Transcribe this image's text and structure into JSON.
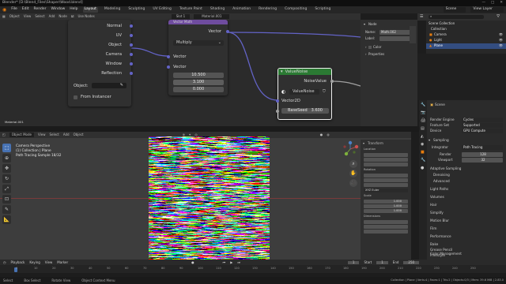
{
  "titlebar": {
    "title": "Blender* [D:\\Blend_Files\\Shaper\\Wood.blend]",
    "controls": [
      "—",
      "□",
      "✕"
    ]
  },
  "topbar": {
    "menus": [
      "File",
      "Edit",
      "Render",
      "Window",
      "Help"
    ],
    "tabs": [
      "Layout",
      "Modeling",
      "Sculpting",
      "UV Editing",
      "Texture Paint",
      "Shading",
      "Animation",
      "Rendering",
      "Compositing",
      "Scripting"
    ],
    "active_tab": "Layout",
    "scene": "Scene",
    "view_layer": "View Layer"
  },
  "node_editor": {
    "header_items": [
      "Object",
      "View",
      "Select",
      "Add",
      "Node",
      "Use Nodes"
    ],
    "slot": "Slot 1",
    "material": "Material.001",
    "material_label": "Material.001",
    "texcoord_outputs": [
      "Normal",
      "UV",
      "Object",
      "Camera",
      "Window",
      "Reflection"
    ],
    "object_label": "Object:",
    "from_instancer": "From Instancer",
    "math_node": {
      "title": "Vector Math",
      "output": "Vector",
      "operation": "Multiply",
      "input1": "Vector",
      "input2": "Vector",
      "values": [
        "10.500",
        "3.100",
        "0.000"
      ]
    },
    "noise_node": {
      "title": "ValueNoise",
      "output": "NoiseValue",
      "group": "ValueNoise",
      "input": "Vector2D",
      "seed_label": "BaseSeed",
      "seed_value": "3.600"
    }
  },
  "node_props": {
    "tab_node": "Node",
    "name_label": "Name:",
    "name_value": "Math.002",
    "label_label": "Label:",
    "color": "Color",
    "properties": "Properties"
  },
  "outliner": {
    "title": "Scene Collection",
    "items": [
      "Scene Collection",
      "Collection",
      "Camera",
      "Light",
      "Plane"
    ]
  },
  "viewport": {
    "header_items": [
      "Object Mode",
      "View",
      "Select",
      "Add",
      "Object"
    ],
    "overlay_lines": [
      "Camera Perspective",
      "(1) Collection | Plane",
      "Path Tracing Sample 18/32"
    ]
  },
  "npanel": {
    "transform": "Transform",
    "location": "Location",
    "rotation": "Rotation",
    "mode": "XYZ Euler",
    "scale": "Scale",
    "scale_values": [
      "1.000",
      "1.000",
      "1.000"
    ],
    "dimensions": "Dimensions"
  },
  "properties": {
    "scene_label": "Scene",
    "render_engine_label": "Render Engine",
    "render_engine": "Cycles",
    "feature_set_label": "Feature Set",
    "feature_set": "Supported",
    "device_label": "Device",
    "device": "GPU Compute",
    "sampling": "Sampling",
    "integrator_label": "Integrator",
    "integrator": "Path Tracing",
    "render_label": "Render",
    "render_value": "128",
    "viewport_label": "Viewport",
    "viewport_value": "32",
    "panels": [
      "Adaptive Sampling",
      "Denoising",
      "Advanced",
      "Light Paths",
      "Volumes",
      "Hair",
      "Simplify",
      "Motion Blur",
      "Film",
      "Performance",
      "Bake",
      "Grease Pencil",
      "Freestyle",
      "Color Management"
    ]
  },
  "timeline": {
    "items": [
      "Playback",
      "Keying",
      "View",
      "Marker"
    ],
    "frame_ticks": [
      "0",
      "10",
      "20",
      "30",
      "40",
      "50",
      "60",
      "70",
      "80",
      "90",
      "100",
      "110",
      "120",
      "130",
      "140",
      "150",
      "160",
      "170",
      "180",
      "190",
      "200",
      "210",
      "220",
      "230",
      "240",
      "250"
    ],
    "current_frame": "1",
    "start_label": "Start",
    "start": "1",
    "end_label": "End",
    "end": "250"
  },
  "statusbar": {
    "items": [
      "Select",
      "Box Select",
      "Rotate View",
      "Object Context Menu"
    ],
    "right": "Collection | Plane | Verts:4 | Faces:1 | Tris:2 | Objects:0/3 | Mem: 39.6 MiB | 2.83.0"
  }
}
